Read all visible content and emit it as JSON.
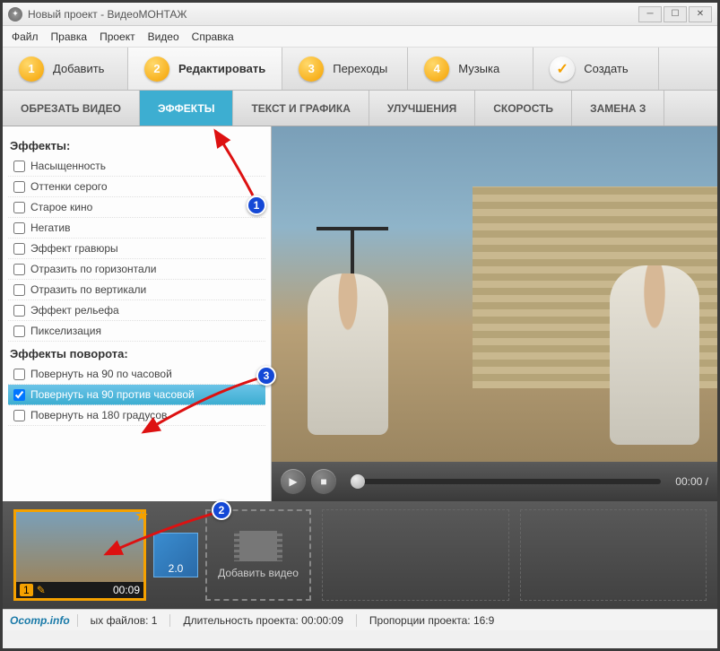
{
  "window": {
    "title": "Новый проект - ВидеоМОНТАЖ"
  },
  "menu": {
    "items": [
      "Файл",
      "Правка",
      "Проект",
      "Видео",
      "Справка"
    ]
  },
  "maintabs": [
    {
      "num": "1",
      "label": "Добавить"
    },
    {
      "num": "2",
      "label": "Редактировать"
    },
    {
      "num": "3",
      "label": "Переходы"
    },
    {
      "num": "4",
      "label": "Музыка"
    },
    {
      "num": "✓",
      "label": "Создать"
    }
  ],
  "subtabs": [
    "ОБРЕЗАТЬ ВИДЕО",
    "ЭФФЕКТЫ",
    "ТЕКСТ И ГРАФИКА",
    "УЛУЧШЕНИЯ",
    "СКОРОСТЬ",
    "ЗАМЕНА З"
  ],
  "effects": {
    "group1_title": "Эффекты:",
    "group1": [
      "Насыщенность",
      "Оттенки серого",
      "Старое кино",
      "Негатив",
      "Эффект гравюры",
      "Отразить по горизонтали",
      "Отразить по вертикали",
      "Эффект рельефа",
      "Пикселизация"
    ],
    "group2_title": "Эффекты поворота:",
    "group2": [
      "Повернуть на 90 по часовой",
      "Повернуть на 90 против часовой",
      "Повернуть на 180 градусов"
    ],
    "selected": "Повернуть на 90 против часовой"
  },
  "player": {
    "time": "00:00 /"
  },
  "timeline": {
    "clip_index": "1",
    "clip_duration": "00:09",
    "transition_duration": "2.0",
    "add_label": "Добавить видео"
  },
  "status": {
    "logo": "Ocomp.info",
    "files_label": "ых файлов:",
    "files_count": "1",
    "duration_label": "Длительность проекта:",
    "duration": "00:00:09",
    "ratio_label": "Пропорции проекта:",
    "ratio": "16:9"
  },
  "annotations": {
    "a1": "1",
    "a2": "2",
    "a3": "3"
  }
}
